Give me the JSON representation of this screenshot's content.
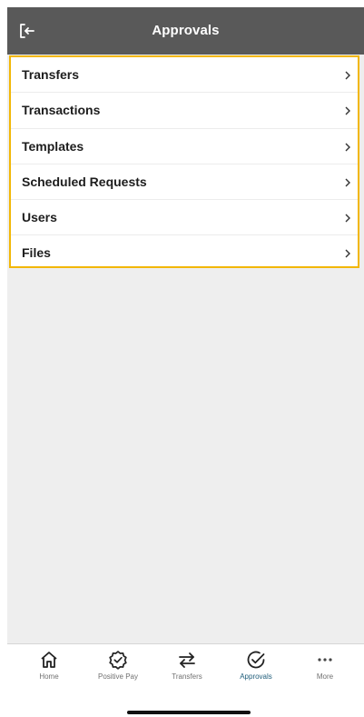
{
  "header": {
    "title": "Approvals",
    "exit_icon": "sign-out-icon"
  },
  "menu": {
    "items": [
      {
        "label": "Transfers"
      },
      {
        "label": "Transactions"
      },
      {
        "label": "Templates"
      },
      {
        "label": "Scheduled Requests"
      },
      {
        "label": "Users"
      },
      {
        "label": "Files"
      }
    ],
    "chevron_icon": "chevron-right-icon",
    "highlight_color": "#f2b705"
  },
  "tabbar": {
    "active": "Approvals",
    "tabs": [
      {
        "label": "Home",
        "icon": "home-icon"
      },
      {
        "label": "Positive Pay",
        "icon": "badge-check-icon"
      },
      {
        "label": "Transfers",
        "icon": "transfer-arrows-icon"
      },
      {
        "label": "Approvals",
        "icon": "check-circle-icon"
      },
      {
        "label": "More",
        "icon": "more-dots-icon"
      }
    ],
    "active_color": "#1f5d7a"
  },
  "colors": {
    "header_bg": "#595959",
    "page_bg": "#eeeeee"
  }
}
